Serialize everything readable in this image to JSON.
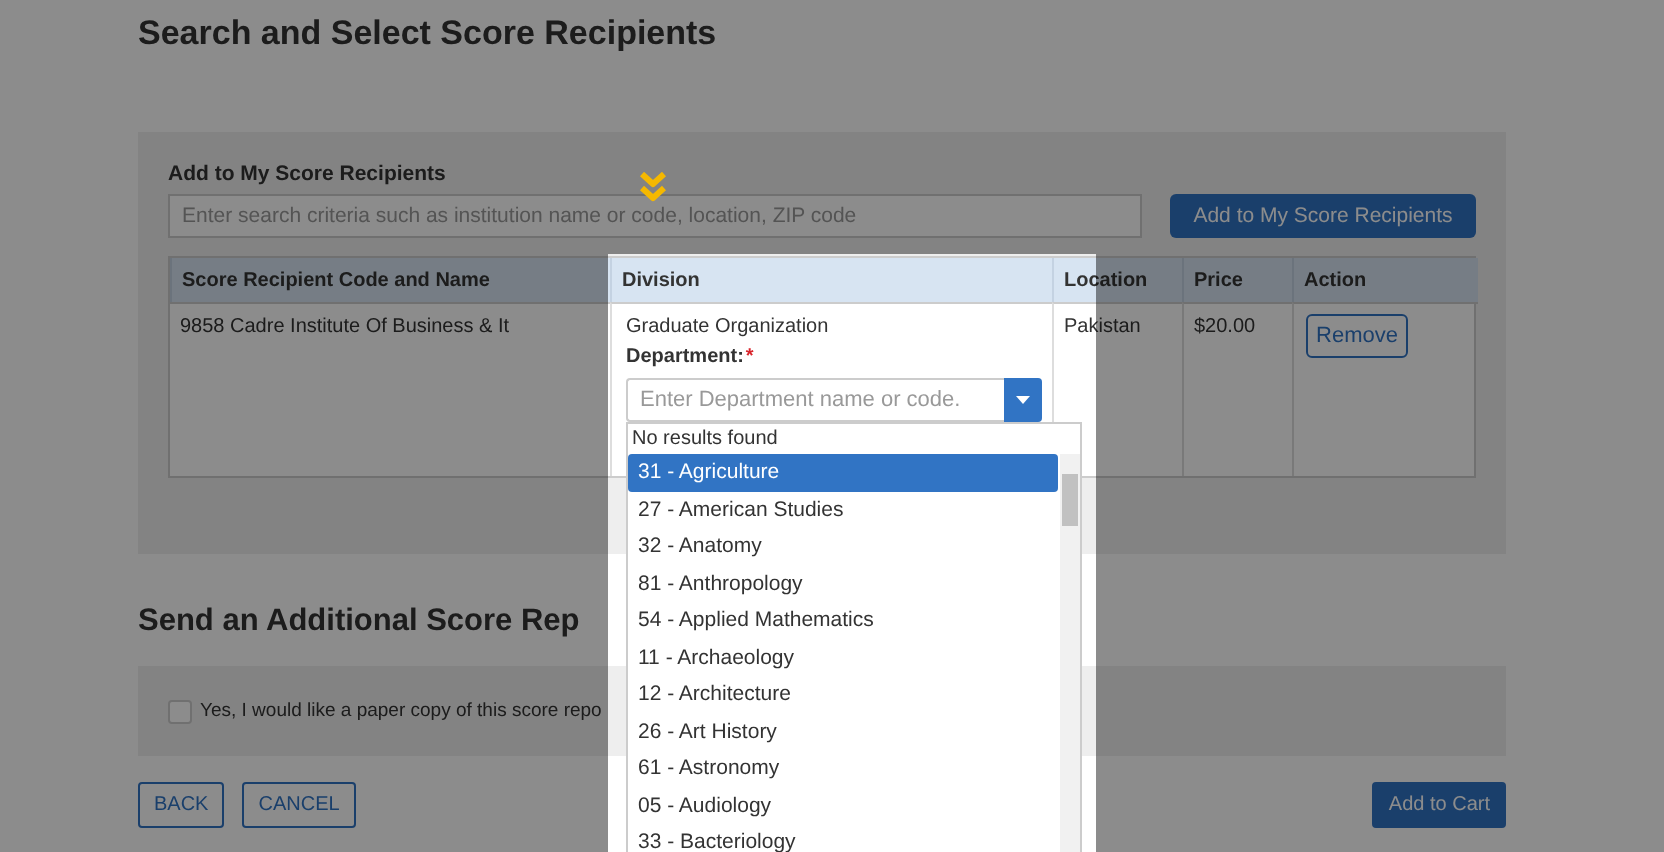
{
  "page_title": "Search and Select Score Recipients",
  "add_recipients": {
    "label": "Add to My Score Recipients",
    "search": {
      "placeholder": "Enter search criteria such as institution name or code, location, ZIP code"
    },
    "add_button": "Add to My Score Recipients"
  },
  "table": {
    "columns": [
      "Score Recipient Code and Name",
      "Division",
      "Location",
      "Price",
      "Action"
    ],
    "rows": [
      {
        "recipient": "9858 Cadre Institute Of Business & It",
        "division": "Graduate Organization",
        "department_label": "Department:",
        "required_mark": "*",
        "department": {
          "placeholder": "Enter Department name or code.",
          "expanded": true,
          "no_results": "No results found",
          "options": [
            {
              "label": "31 - Agriculture",
              "selected": true
            },
            {
              "label": "27 - American Studies",
              "selected": false
            },
            {
              "label": "32 - Anatomy",
              "selected": false
            },
            {
              "label": "81 - Anthropology",
              "selected": false
            },
            {
              "label": "54 - Applied Mathematics",
              "selected": false
            },
            {
              "label": "11 - Archaeology",
              "selected": false
            },
            {
              "label": "12 - Architecture",
              "selected": false
            },
            {
              "label": "26 - Art History",
              "selected": false
            },
            {
              "label": "61 - Astronomy",
              "selected": false
            },
            {
              "label": "05 - Audiology",
              "selected": false
            },
            {
              "label": "33 - Bacteriology",
              "selected": false
            }
          ]
        },
        "location": "Pakistan",
        "price": "$20.00",
        "action": "Remove"
      }
    ]
  },
  "additional": {
    "title": "Send an Additional Score Rep",
    "paper_copy": {
      "label": "Yes, I would like a paper copy of this score repo",
      "checked": false
    }
  },
  "buttons": [
    {
      "label": "BACK",
      "kind": "outline"
    },
    {
      "label": "CANCEL",
      "kind": "outline"
    },
    {
      "label": "Add to Cart",
      "kind": "primary"
    }
  ]
}
